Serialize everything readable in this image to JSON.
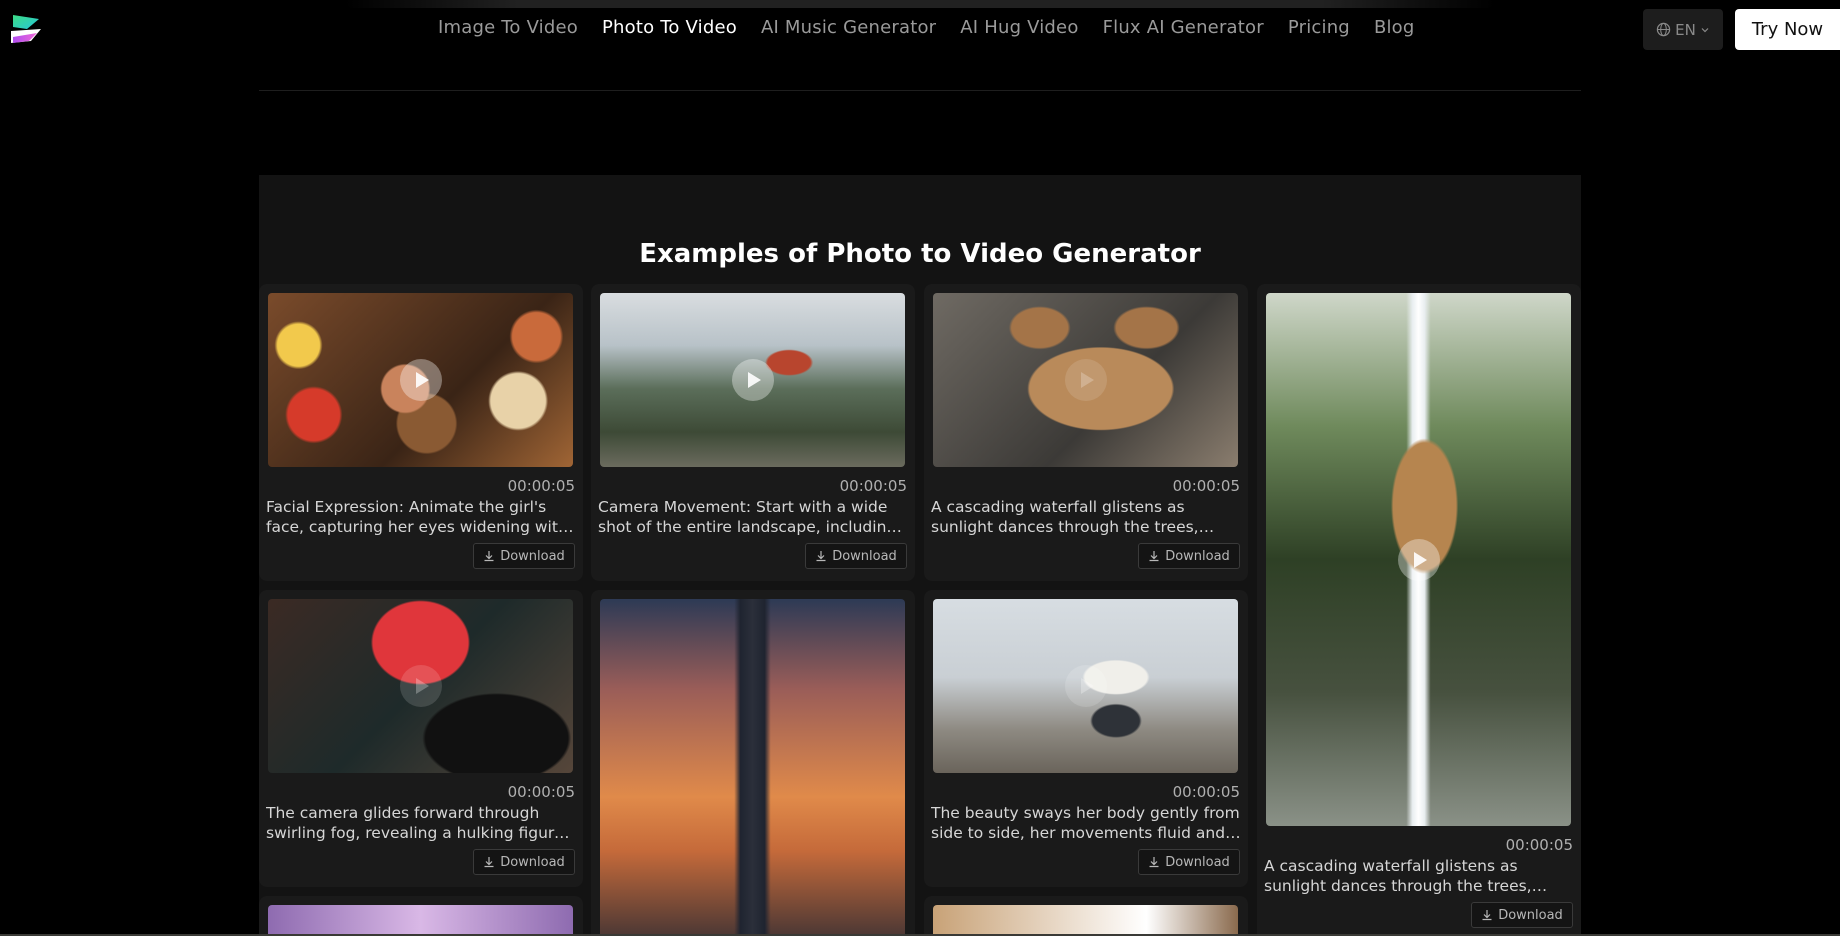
{
  "header": {
    "nav": [
      {
        "label": "Image To Video",
        "active": false
      },
      {
        "label": "Photo To Video",
        "active": true
      },
      {
        "label": "AI Music Generator",
        "active": false
      },
      {
        "label": "AI Hug Video",
        "active": false
      },
      {
        "label": "Flux AI Generator",
        "active": false
      },
      {
        "label": "Pricing",
        "active": false
      },
      {
        "label": "Blog",
        "active": false
      }
    ],
    "language": "EN",
    "try_now": "Try Now",
    "icons": {
      "logo": "logo-icon",
      "globe": "globe-icon",
      "chevron": "chevron-down-icon"
    }
  },
  "section": {
    "title": "Examples of Photo to Video Generator"
  },
  "download_label": "Download",
  "examples": [
    {
      "duration": "00:00:05",
      "text": "Facial Expression: Animate the girl's face, capturing her eyes widening with delight as she hugs her teddy bear tightly."
    },
    {
      "duration": "00:00:05",
      "text": "Camera Movement: Start with a wide shot of the entire landscape, including the temple perched on the cliff."
    },
    {
      "duration": "00:00:05",
      "text": "A cascading waterfall glistens as sunlight dances through the trees, illuminating the scene."
    },
    {
      "duration": "00:00:05",
      "text": "A cascading waterfall glistens as sunlight dances through the trees, illuminating the modern house above."
    },
    {
      "duration": "00:00:05",
      "text": "The camera glides forward through swirling fog, revealing a hulking figure beneath the neon sign."
    },
    {
      "duration": "00:00:05",
      "text": "The beauty sways her body gently from side to side, her movements fluid and graceful."
    }
  ],
  "colors": {
    "background": "#000000",
    "section": "#131313",
    "card": "#1a1a1a",
    "nav_inactive": "#9a9a9a",
    "nav_active": "#ffffff",
    "logo_green": "#3ddc84",
    "logo_purple": "#b14cf0"
  }
}
